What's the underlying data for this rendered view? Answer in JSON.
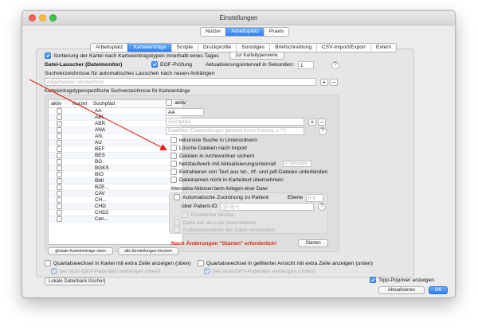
{
  "window": {
    "title": "Einstellungen"
  },
  "top_tabs": [
    {
      "label": "Nutzer",
      "active": false
    },
    {
      "label": "Arbeitsplatz",
      "active": true
    },
    {
      "label": "Praxis",
      "active": false
    }
  ],
  "sub_tabs": [
    {
      "label": "Arbeitsplatz",
      "active": false
    },
    {
      "label": "Karteieinträge",
      "active": true
    },
    {
      "label": "Scripte",
      "active": false
    },
    {
      "label": "Druckprofile",
      "active": false
    },
    {
      "label": "Sonstiges",
      "active": false
    },
    {
      "label": "Briefschreibung",
      "active": false
    },
    {
      "label": "CSV-Import/Export",
      "active": false
    },
    {
      "label": "Extern",
      "active": false
    }
  ],
  "sort": {
    "label": "Sortierung der Kartei nach Karteieintragstypen innerhalb eines Tages",
    "checked": true,
    "button": "zur Karteitypenverw."
  },
  "lauscher": {
    "heading": "Datei-Lauscher (Dateimonitor)",
    "eof_label": "EOF-Prüfung",
    "eof_checked": true,
    "interval_label": "Aktualisierungsintervall in Sekunden:",
    "interval_value": "1",
    "dirs_label": "Suchverzeichnisse für automatisches Lauschen nach neuen Anhängen",
    "dirs_placeholder": "Allgemeines Verzeichnis",
    "plus": "+",
    "minus": "–"
  },
  "type_dirs_label": "Karteieintragstypenspezifische Suchverzeichnisse für Karteianhänge",
  "table": {
    "headers": [
      "aktiv",
      "Kurzel",
      "Suchpfad"
    ],
    "rows": [
      "AA",
      "ABL",
      "ABR",
      "ANA",
      "AN..",
      "AU",
      "BEF",
      "BES",
      "BG",
      "BGKS",
      "BIO",
      "BMI",
      "BZE...",
      "CAV",
      "CH...",
      "CHD",
      "CHD2",
      "Cen..."
    ],
    "btn_all_on": "globale Karteieinträge oben",
    "btn_all_off": "alle Einstellungen löschen"
  },
  "right": {
    "aktiv_label": "aktiv",
    "kuerzel_value": "AA",
    "suchpfad_placeholder": "Suchpfad",
    "dateifilter_placeholder": "Dateifilter (Dateiendungen getrennt durch Komma, z.*?)",
    "options": [
      {
        "label": "rekursive Suche in Unterordnern",
        "checked": false
      },
      {
        "label": "Lösche Dateien nach Import",
        "checked": false
      },
      {
        "label": "Dateien in Archivordner sichern",
        "checked": false
      },
      {
        "label": "Netzlaufwerk mit Aktualisierungsintervall",
        "checked": false
      },
      {
        "label": "Extrahieren von Text aus txt-, rtf- und pdf-Dateien unterbinden",
        "checked": false
      },
      {
        "label": "Dateinamen nicht in Karteitext übernehmen",
        "checked": false
      }
    ],
    "interval_placeholder": "in Sekunden",
    "alt_heading": "Alternative Aktionen beim Anlegen einer Datei",
    "auto_assign_label": "Automatische Zuordnung zu Patient",
    "ebene_label": "Ebene",
    "ebene_value": "0",
    "patient_id_label": "über Patient-ID:",
    "patient_id_placeholder": "([0-9]+)",
    "extended_label": "Erweiterter Modus",
    "link_label": "Datei nur als Link übernehmen",
    "change_date_label": "Änderungsdatum der Datei verwenden",
    "warning": "Nach Änderungen \"Starten\" erforderlich!",
    "start_button": "Starten"
  },
  "bottom": {
    "quartal_left": "Quartalswechsel in Kartei mit extra Zeile anzeigen (oben)",
    "quartal_left_sub": "bei nicht-GKV-Patienten verbergen (oben)",
    "quartal_right": "Quartalswechsel in gefilterter Ansicht mit extra Zeile anzeigen (unten)",
    "quartal_right_sub": "bei nicht-GKV-Patienten verbergen (unten)",
    "local_db_button": "Lokale Datenbank löschen",
    "tipp_label": "Tipp-Popover anzeigen",
    "tipp_checked": true,
    "refresh_button": "Aktualisieren",
    "ok_button": "OK"
  },
  "colors": {
    "accent": "#2f7ef4",
    "warning": "#e0201a",
    "arrow": "#e0201a"
  }
}
